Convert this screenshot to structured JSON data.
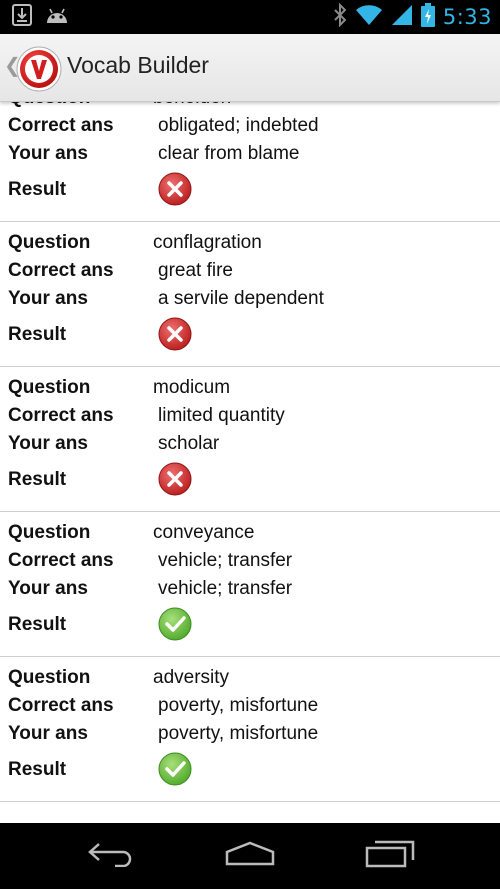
{
  "status_bar": {
    "time": "5:33",
    "icons": [
      "download-icon",
      "android-icon",
      "bluetooth-icon",
      "wifi-icon",
      "signal-icon",
      "battery-icon"
    ],
    "clock_color": "#33b5e5"
  },
  "action_bar": {
    "title": "Vocab Builder",
    "logo_letter": "V",
    "logo_color": "#d11f1f"
  },
  "labels": {
    "question": "Question",
    "correct": "Correct ans",
    "yours": "Your ans",
    "result": "Result"
  },
  "results": [
    {
      "question": "beholden",
      "correct": "obligated; indebted",
      "yours": "clear from blame",
      "result": "incorrect"
    },
    {
      "question": "conflagration",
      "correct": "great fire",
      "yours": "a servile dependent",
      "result": "incorrect"
    },
    {
      "question": "modicum",
      "correct": "limited quantity",
      "yours": "scholar",
      "result": "incorrect"
    },
    {
      "question": "conveyance",
      "correct": "vehicle; transfer",
      "yours": "vehicle; transfer",
      "result": "correct"
    },
    {
      "question": "adversity",
      "correct": "poverty, misfortune",
      "yours": "poverty, misfortune",
      "result": "correct"
    }
  ],
  "colors": {
    "correct": "#5cb82c",
    "incorrect": "#cc2424"
  },
  "nav_bar": {
    "buttons": [
      "back-icon",
      "home-icon",
      "recents-icon"
    ]
  }
}
